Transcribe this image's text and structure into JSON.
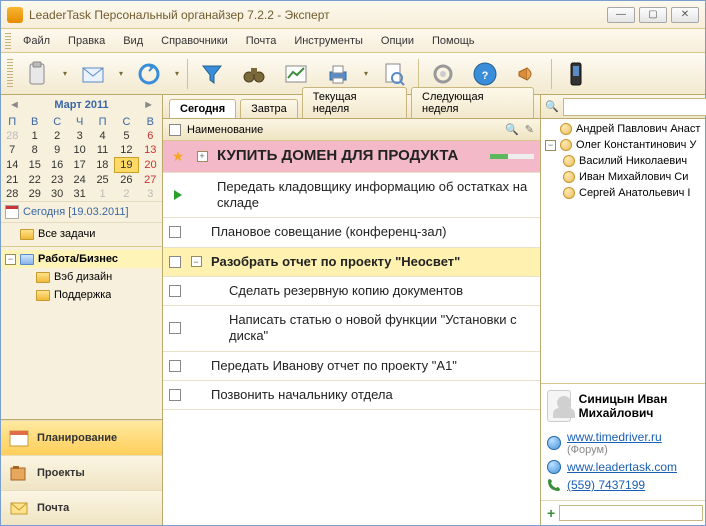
{
  "window": {
    "title": "LeaderTask Персональный органайзер 7.2.2 - Эксперт"
  },
  "menu": {
    "file": "Файл",
    "edit": "Правка",
    "view": "Вид",
    "ref": "Справочники",
    "mail": "Почта",
    "tools": "Инструменты",
    "options": "Опции",
    "help": "Помощь"
  },
  "calendar": {
    "month": "Март 2011",
    "dow": [
      "П",
      "В",
      "С",
      "Ч",
      "П",
      "С",
      "В"
    ],
    "rows": [
      [
        {
          "d": 28,
          "o": 1
        },
        {
          "d": 1
        },
        {
          "d": 2
        },
        {
          "d": 3
        },
        {
          "d": 4
        },
        {
          "d": 5
        },
        {
          "d": 6,
          "s": 1
        }
      ],
      [
        {
          "d": 7
        },
        {
          "d": 8
        },
        {
          "d": 9
        },
        {
          "d": 10
        },
        {
          "d": 11
        },
        {
          "d": 12
        },
        {
          "d": 13,
          "s": 1
        }
      ],
      [
        {
          "d": 14
        },
        {
          "d": 15
        },
        {
          "d": 16
        },
        {
          "d": 17
        },
        {
          "d": 18
        },
        {
          "d": 19,
          "t": 1
        },
        {
          "d": 20,
          "s": 1
        }
      ],
      [
        {
          "d": 21
        },
        {
          "d": 22
        },
        {
          "d": 23
        },
        {
          "d": 24
        },
        {
          "d": 25
        },
        {
          "d": 26
        },
        {
          "d": 27,
          "s": 1
        }
      ],
      [
        {
          "d": 28
        },
        {
          "d": 29
        },
        {
          "d": 30
        },
        {
          "d": 31
        },
        {
          "d": 1,
          "o": 1
        },
        {
          "d": 2,
          "o": 1
        },
        {
          "d": 3,
          "o": 1
        }
      ]
    ],
    "today_label": "Сегодня [19.03.2011]"
  },
  "tree": {
    "all": "Все задачи",
    "work": "Работа/Бизнес",
    "web": "Вэб дизайн",
    "support": "Поддержка"
  },
  "nav": {
    "planning": "Планирование",
    "projects": "Проекты",
    "mail": "Почта"
  },
  "tabs": {
    "today": "Сегодня",
    "tomorrow": "Завтра",
    "week": "Текущая неделя",
    "nextweek": "Следующая неделя"
  },
  "list_header": "Наименование",
  "tasks": {
    "t1": "КУПИТЬ ДОМЕН ДЛЯ ПРОДУКТА",
    "t2": "Передать кладовщику информацию об остатках на складе",
    "t3": "Плановое совещание (конференц-зал)",
    "t4": "Разобрать отчет по проекту \"Неосвет\"",
    "t5": "Сделать резервную копию документов",
    "t6": "Написать статью о новой функции \"Установки с диска\"",
    "t7": "Передать Иванову отчет по проекту \"А1\"",
    "t8": "Позвонить начальнику отдела"
  },
  "search_placeholder": "",
  "contacts": {
    "c1": "Андрей Павлович Анаст",
    "c2": "Олег Константинович У",
    "c3": "Василий Николаевич",
    "c4": "Иван Михайлович Си",
    "c5": "Сергей Анатольевич I"
  },
  "card": {
    "name": "Синицын Иван Михайлович",
    "link1": "www.timedriver.ru",
    "link1sub": "(Форум)",
    "link2": "www.leadertask.com",
    "phone": "(559) 7437199"
  }
}
